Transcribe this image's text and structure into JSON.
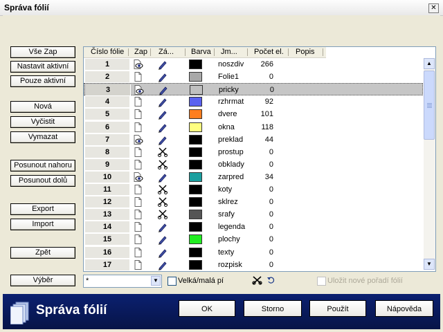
{
  "window": {
    "title": "Správa fólií",
    "close_glyph": "✕"
  },
  "side_buttons": {
    "all_on": "Vše Zap",
    "set_active": "Nastavit aktivní",
    "only_active": "Pouze aktivní",
    "new": "Nová",
    "clear": "Vyčistit",
    "delete": "Vymazat",
    "move_up": "Posunout nahoru",
    "move_down": "Posunout dolů",
    "export": "Export",
    "import": "Import",
    "back": "Zpět",
    "select": "Výběr"
  },
  "table": {
    "columns": [
      "Číslo fólie",
      "Zap",
      "Zá...",
      "Barva",
      "Jm...",
      "Počet el.",
      "Popis"
    ],
    "rows": [
      {
        "num": "1",
        "visible": "eye",
        "edit": "pencil",
        "color": "#000000",
        "name": "noszdiv",
        "count": "266"
      },
      {
        "num": "2",
        "visible": "page",
        "edit": "pencil",
        "color": "#a8a8a8",
        "name": "Folie1",
        "count": "0"
      },
      {
        "num": "3",
        "visible": "eye",
        "edit": "pencil",
        "color": "#c0c0c0",
        "name": "pricky",
        "count": "0",
        "selected": true
      },
      {
        "num": "4",
        "visible": "page",
        "edit": "pencil",
        "color": "#5a62f0",
        "name": "rzhrmat",
        "count": "92"
      },
      {
        "num": "5",
        "visible": "page",
        "edit": "pencil",
        "color": "#ff7e1f",
        "name": "dvere",
        "count": "101"
      },
      {
        "num": "6",
        "visible": "page",
        "edit": "pencil",
        "color": "#ffff80",
        "name": "okna",
        "count": "118"
      },
      {
        "num": "7",
        "visible": "eye",
        "edit": "pencil",
        "color": "#000000",
        "name": "preklad",
        "count": "44"
      },
      {
        "num": "8",
        "visible": "page",
        "edit": "scissor",
        "color": "#000000",
        "name": "prostup",
        "count": "0"
      },
      {
        "num": "9",
        "visible": "page",
        "edit": "scissor",
        "color": "#000000",
        "name": "obklady",
        "count": "0"
      },
      {
        "num": "10",
        "visible": "eye",
        "edit": "pencil",
        "color": "#1a9f9f",
        "name": "zarpred",
        "count": "34"
      },
      {
        "num": "11",
        "visible": "page",
        "edit": "scissor",
        "color": "#000000",
        "name": "koty",
        "count": "0"
      },
      {
        "num": "12",
        "visible": "page",
        "edit": "scissor",
        "color": "#000000",
        "name": "sklrez",
        "count": "0"
      },
      {
        "num": "13",
        "visible": "page",
        "edit": "scissor",
        "color": "#555555",
        "name": "srafy",
        "count": "0"
      },
      {
        "num": "14",
        "visible": "page",
        "edit": "pencil",
        "color": "#000000",
        "name": "legenda",
        "count": "0"
      },
      {
        "num": "15",
        "visible": "page",
        "edit": "pencil",
        "color": "#22ee22",
        "name": "plochy",
        "count": "0"
      },
      {
        "num": "16",
        "visible": "page",
        "edit": "pencil",
        "color": "#000000",
        "name": "texty",
        "count": "0"
      },
      {
        "num": "17",
        "visible": "page",
        "edit": "pencil",
        "color": "#000000",
        "name": "rozpisk",
        "count": "0"
      }
    ]
  },
  "filter": {
    "combo_value": "*",
    "case_label": "Velká/malá pí",
    "save_order_label": "Uložit nové pořadí fólií"
  },
  "footer": {
    "brand": "Správa fólií",
    "ok": "OK",
    "cancel": "Storno",
    "apply": "Použít",
    "help": "Nápověda"
  }
}
